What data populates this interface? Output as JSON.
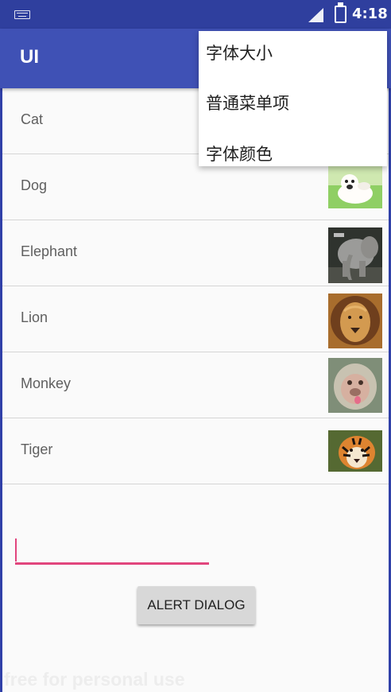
{
  "status": {
    "time": "4:18",
    "icons": [
      "keyboard-icon",
      "signal-icon",
      "battery-charging-icon"
    ]
  },
  "app": {
    "title": "UI",
    "primary_color": "#3f51b5",
    "status_color": "#2f3f9e",
    "accent_color": "#e1457d"
  },
  "animals": [
    {
      "label": "Cat",
      "thumbnail": null
    },
    {
      "label": "Dog",
      "thumbnail": "dog-image"
    },
    {
      "label": "Elephant",
      "thumbnail": "elephant-image"
    },
    {
      "label": "Lion",
      "thumbnail": "lion-image"
    },
    {
      "label": "Monkey",
      "thumbnail": "monkey-image"
    },
    {
      "label": "Tiger",
      "thumbnail": "tiger-image"
    }
  ],
  "menu": {
    "items": [
      "字体大小",
      "普通菜单项",
      "字体颜色"
    ]
  },
  "input": {
    "value": ""
  },
  "button": {
    "label": "ALERT DIALOG"
  },
  "watermark": "free for personal use"
}
